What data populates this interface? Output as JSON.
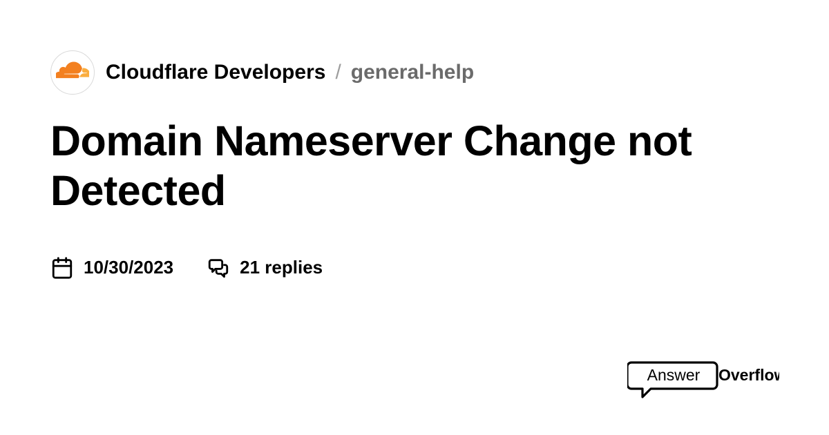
{
  "breadcrumb": {
    "server": "Cloudflare Developers",
    "separator": "/",
    "channel": "general-help"
  },
  "title": "Domain Nameserver Change not Detected",
  "meta": {
    "date": "10/30/2023",
    "replies": "21 replies"
  },
  "footer": {
    "brand_left": "Answer",
    "brand_right": "Overflow"
  },
  "colors": {
    "cloudflare_orange": "#f38020",
    "text_primary": "#000000",
    "text_muted": "#6b6b6b",
    "separator": "#9e9e9e"
  }
}
